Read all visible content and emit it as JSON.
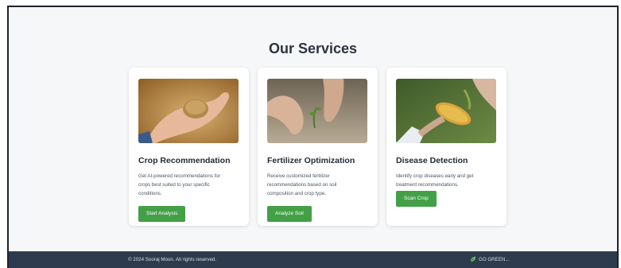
{
  "section": {
    "title": "Our Services"
  },
  "cards": [
    {
      "title": "Crop Recommendation",
      "description": "Get AI-powered recommendations for crops best suited to your specific conditions.",
      "button": "Start Analysis",
      "image_icon": "hands-holding-grain-photo"
    },
    {
      "title": "Fertilizer Optimization",
      "description": "Receive customized fertilizer recommendations based on soil composition and crop type.",
      "button": "Analyze Soil",
      "image_icon": "hands-planting-seedling-photo"
    },
    {
      "title": "Disease Detection",
      "description": "Identify crop diseases early and get treatment recommendations.",
      "button": "Scan Crop",
      "image_icon": "corn-cob-inspection-photo"
    }
  ],
  "footer": {
    "copyright": "© 2024 Sooraj Moon. All rights reserved.",
    "tagline": "GO GREEN..."
  },
  "colors": {
    "button": "#43a047",
    "footer_bg": "#2e3b4e",
    "page_bg": "#f6f7f8",
    "title": "#2b3440"
  }
}
